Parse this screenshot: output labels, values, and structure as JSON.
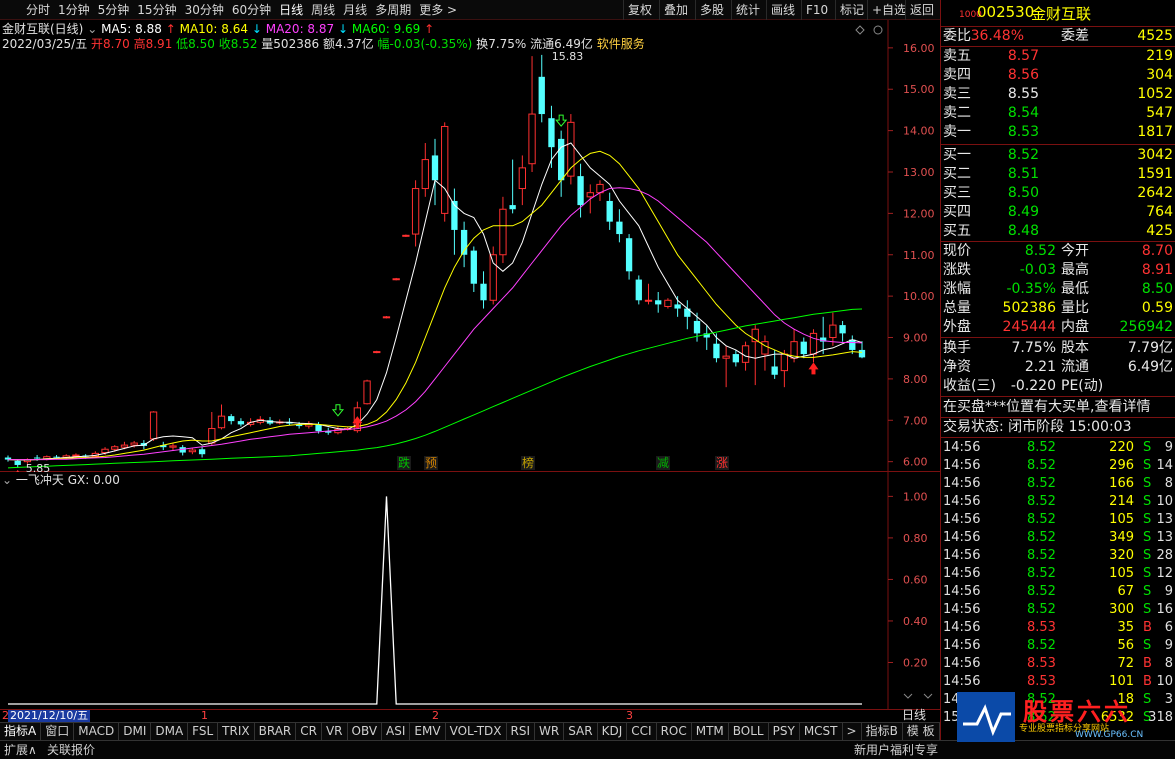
{
  "toolbar": {
    "timeframes": [
      "分时",
      "1分钟",
      "5分钟",
      "15分钟",
      "30分钟",
      "60分钟",
      "日线",
      "周线",
      "月线",
      "多周期",
      "更多 >"
    ],
    "active_timeframe": "日线",
    "right_buttons": [
      "复权",
      "叠加",
      "多股",
      "统计",
      "画线",
      "F10",
      "标记",
      "+自选",
      "返回"
    ]
  },
  "chart_header": {
    "title": "金财互联(日线)",
    "ma5": "MA5: 8.88",
    "ma10": "MA10: 8.64",
    "ma20": "MA20: 8.87",
    "ma60": "MA60: 9.69",
    "date": "2022/03/25/五",
    "open": "开8.70",
    "high": "高8.91",
    "low": "低8.50",
    "close": "收8.52",
    "vol": "量502386",
    "amount": "额4.37亿",
    "change": "幅-0.03(-0.35%)",
    "turnover": "换7.75%",
    "float": "流通6.49亿",
    "industry": "软件服务"
  },
  "chart_annotations": {
    "high_label": "15.83",
    "low_label": "5.85",
    "tags": [
      "跌",
      "预",
      "榜",
      "减",
      "涨"
    ]
  },
  "indicator_header": {
    "name": "一飞冲天",
    "gx": "GX: 0.00"
  },
  "bottom_axis": {
    "date_box": "2021/12/10/五",
    "months": [
      "1",
      "2",
      "3"
    ],
    "period": "日线"
  },
  "tabs": [
    "指标A",
    "窗口",
    "MACD",
    "DMI",
    "DMA",
    "FSL",
    "TRIX",
    "BRAR",
    "CR",
    "VR",
    "OBV",
    "ASI",
    "EMV",
    "VOL-TDX",
    "RSI",
    "WR",
    "SAR",
    "KDJ",
    "CCI",
    "ROC",
    "MTM",
    "BOLL",
    "PSY",
    "MCST",
    ">",
    "指标B",
    "模 板"
  ],
  "status": {
    "expand": "扩展∧",
    "linked": "关联报价",
    "news": "新用户福利专享"
  },
  "stock": {
    "code_prefix": "1000",
    "code": "002530",
    "name": "金财互联",
    "weibi_label": "委比",
    "weibi": "36.48%",
    "weicha_label": "委差",
    "weicha": "4525"
  },
  "asks": [
    {
      "label": "卖五",
      "price": "8.57",
      "vol": "219"
    },
    {
      "label": "卖四",
      "price": "8.56",
      "vol": "304"
    },
    {
      "label": "卖三",
      "price": "8.55",
      "vol": "1052"
    },
    {
      "label": "卖二",
      "price": "8.54",
      "vol": "547"
    },
    {
      "label": "卖一",
      "price": "8.53",
      "vol": "1817"
    }
  ],
  "bids": [
    {
      "label": "买一",
      "price": "8.52",
      "vol": "3042"
    },
    {
      "label": "买二",
      "price": "8.51",
      "vol": "1591"
    },
    {
      "label": "买三",
      "price": "8.50",
      "vol": "2642"
    },
    {
      "label": "买四",
      "price": "8.49",
      "vol": "764"
    },
    {
      "label": "买五",
      "price": "8.48",
      "vol": "425"
    }
  ],
  "quote": [
    {
      "l1": "现价",
      "v1": "8.52",
      "l2": "今开",
      "v2": "8.70"
    },
    {
      "l1": "涨跌",
      "v1": "-0.03",
      "l2": "最高",
      "v2": "8.91"
    },
    {
      "l1": "涨幅",
      "v1": "-0.35%",
      "l2": "最低",
      "v2": "8.50"
    },
    {
      "l1": "总量",
      "v1": "502386",
      "l2": "量比",
      "v2": "0.59"
    },
    {
      "l1": "外盘",
      "v1": "245444",
      "l2": "内盘",
      "v2": "256942"
    }
  ],
  "quote2": [
    {
      "l1": "换手",
      "v1": "7.75%",
      "l2": "股本",
      "v2": "7.79亿"
    },
    {
      "l1": "净资",
      "v1": "2.21",
      "l2": "流通",
      "v2": "6.49亿"
    },
    {
      "l1": "收益(三)",
      "v1": "-0.220",
      "l2": "PE(动)",
      "v2": ""
    }
  ],
  "notice": "在买盘***位置有大买单,查看详情",
  "trade_status": "交易状态: 闭市阶段 15:00:03",
  "ticks": [
    {
      "t": "14:56",
      "p": "8.52",
      "q": "220",
      "d": "S",
      "n": "9"
    },
    {
      "t": "14:56",
      "p": "8.52",
      "q": "296",
      "d": "S",
      "n": "14"
    },
    {
      "t": "14:56",
      "p": "8.52",
      "q": "166",
      "d": "S",
      "n": "8"
    },
    {
      "t": "14:56",
      "p": "8.52",
      "q": "214",
      "d": "S",
      "n": "10"
    },
    {
      "t": "14:56",
      "p": "8.52",
      "q": "105",
      "d": "S",
      "n": "13"
    },
    {
      "t": "14:56",
      "p": "8.52",
      "q": "349",
      "d": "S",
      "n": "13"
    },
    {
      "t": "14:56",
      "p": "8.52",
      "q": "320",
      "d": "S",
      "n": "28"
    },
    {
      "t": "14:56",
      "p": "8.52",
      "q": "105",
      "d": "S",
      "n": "12"
    },
    {
      "t": "14:56",
      "p": "8.52",
      "q": "67",
      "d": "S",
      "n": "9"
    },
    {
      "t": "14:56",
      "p": "8.52",
      "q": "300",
      "d": "S",
      "n": "16"
    },
    {
      "t": "14:56",
      "p": "8.53",
      "q": "35",
      "d": "B",
      "n": "6"
    },
    {
      "t": "14:56",
      "p": "8.52",
      "q": "56",
      "d": "S",
      "n": "9"
    },
    {
      "t": "14:56",
      "p": "8.53",
      "q": "72",
      "d": "B",
      "n": "8"
    },
    {
      "t": "14:56",
      "p": "8.53",
      "q": "101",
      "d": "B",
      "n": "10"
    },
    {
      "t": "14:57",
      "p": "8.52",
      "q": "18",
      "d": "S",
      "n": "3"
    },
    {
      "t": "15:00",
      "p": "8.52",
      "q": "6532",
      "d": "S",
      "n": "318"
    }
  ],
  "watermark": {
    "text": "股票六六",
    "url": "WWW.GP66.CN",
    "slogan": "专业股票指标分享网站"
  },
  "chart_data": [
    {
      "type": "candlestick",
      "title": "金财互联(日线)",
      "y_ticks": [
        "16.00",
        "15.00",
        "14.00",
        "13.00",
        "12.00",
        "11.00",
        "10.00",
        "9.00",
        "8.00",
        "7.00",
        "6.00"
      ],
      "ylim": [
        5.75,
        16.4
      ],
      "candles": [
        [
          6.1,
          6.05,
          6.15,
          6.0
        ],
        [
          6.02,
          5.92,
          6.06,
          5.85
        ],
        [
          6.0,
          6.05,
          6.08,
          5.95
        ],
        [
          6.1,
          6.08,
          6.16,
          6.02
        ],
        [
          6.07,
          6.12,
          6.15,
          6.03
        ],
        [
          6.12,
          6.1,
          6.16,
          6.05
        ],
        [
          6.1,
          6.14,
          6.18,
          6.06
        ],
        [
          6.14,
          6.16,
          6.2,
          6.08
        ],
        [
          6.15,
          6.12,
          6.18,
          6.07
        ],
        [
          6.13,
          6.2,
          6.25,
          6.1
        ],
        [
          6.22,
          6.3,
          6.35,
          6.16
        ],
        [
          6.3,
          6.36,
          6.4,
          6.24
        ],
        [
          6.35,
          6.4,
          6.48,
          6.3
        ],
        [
          6.4,
          6.45,
          6.5,
          6.34
        ],
        [
          6.45,
          6.38,
          6.52,
          6.3
        ],
        [
          6.55,
          7.2,
          7.22,
          6.5
        ],
        [
          6.4,
          6.35,
          6.48,
          6.28
        ],
        [
          6.35,
          6.38,
          6.44,
          6.28
        ],
        [
          6.35,
          6.22,
          6.4,
          6.15
        ],
        [
          6.24,
          6.28,
          6.34,
          6.18
        ],
        [
          6.3,
          6.18,
          6.36,
          6.1
        ],
        [
          6.45,
          6.8,
          7.2,
          6.4
        ],
        [
          6.82,
          7.1,
          7.38,
          6.78
        ],
        [
          7.1,
          6.98,
          7.15,
          6.9
        ],
        [
          6.98,
          6.9,
          7.05,
          6.85
        ],
        [
          6.9,
          6.95,
          7.05,
          6.85
        ],
        [
          6.95,
          7.02,
          7.1,
          6.9
        ],
        [
          7.0,
          6.92,
          7.08,
          6.88
        ],
        [
          6.94,
          6.96,
          7.02,
          6.9
        ],
        [
          6.96,
          6.92,
          7.05,
          6.88
        ],
        [
          6.9,
          6.86,
          6.96,
          6.8
        ],
        [
          6.86,
          6.92,
          6.98,
          6.8
        ],
        [
          6.9,
          6.74,
          6.96,
          6.68
        ],
        [
          6.74,
          6.7,
          6.82,
          6.65
        ],
        [
          6.7,
          6.78,
          6.86,
          6.66
        ],
        [
          6.78,
          6.8,
          6.85,
          6.75
        ],
        [
          6.75,
          7.3,
          7.45,
          6.7
        ],
        [
          7.4,
          7.95,
          7.98,
          7.38
        ],
        [
          8.65,
          8.66,
          8.68,
          8.62
        ],
        [
          9.48,
          9.5,
          9.52,
          9.46
        ],
        [
          10.4,
          10.42,
          10.44,
          10.38
        ],
        [
          11.45,
          11.47,
          11.49,
          11.43
        ],
        [
          11.5,
          12.6,
          12.8,
          11.2
        ],
        [
          12.6,
          13.3,
          13.7,
          12.4
        ],
        [
          13.4,
          12.8,
          13.8,
          12.2
        ],
        [
          12.0,
          14.1,
          14.2,
          11.8
        ],
        [
          12.3,
          11.6,
          12.6,
          11.0
        ],
        [
          11.6,
          11.0,
          11.8,
          10.7
        ],
        [
          11.1,
          10.3,
          11.2,
          10.1
        ],
        [
          10.3,
          9.9,
          10.6,
          9.7
        ],
        [
          9.9,
          11.0,
          11.2,
          9.8
        ],
        [
          11.0,
          12.1,
          12.4,
          10.8
        ],
        [
          12.2,
          12.1,
          13.3,
          12.0
        ],
        [
          12.6,
          13.1,
          13.4,
          12.2
        ],
        [
          13.2,
          14.4,
          15.8,
          13.0
        ],
        [
          15.3,
          14.4,
          15.83,
          14.2
        ],
        [
          14.3,
          13.6,
          14.6,
          13.1
        ],
        [
          13.8,
          12.8,
          14.0,
          12.4
        ],
        [
          12.9,
          14.2,
          14.4,
          12.7
        ],
        [
          12.9,
          12.2,
          13.2,
          11.9
        ],
        [
          12.4,
          12.5,
          12.7,
          12.0
        ],
        [
          12.5,
          12.7,
          12.8,
          12.3
        ],
        [
          12.3,
          11.8,
          12.5,
          11.6
        ],
        [
          11.8,
          11.5,
          12.1,
          11.3
        ],
        [
          11.4,
          10.6,
          11.5,
          10.4
        ],
        [
          10.4,
          9.9,
          10.5,
          9.8
        ],
        [
          9.9,
          9.9,
          10.3,
          9.8
        ],
        [
          9.9,
          9.8,
          10.1,
          9.6
        ],
        [
          9.75,
          9.9,
          9.95,
          9.7
        ],
        [
          9.8,
          9.7,
          10.0,
          9.5
        ],
        [
          9.7,
          9.5,
          9.9,
          9.2
        ],
        [
          9.4,
          9.1,
          9.6,
          8.9
        ],
        [
          9.1,
          9.0,
          9.3,
          8.7
        ],
        [
          8.85,
          8.5,
          9.1,
          8.4
        ],
        [
          8.5,
          8.55,
          8.8,
          7.8
        ],
        [
          8.6,
          8.4,
          8.7,
          8.3
        ],
        [
          8.4,
          8.8,
          8.9,
          8.2
        ],
        [
          8.9,
          9.2,
          9.3,
          7.85
        ],
        [
          8.6,
          8.9,
          9.05,
          8.2
        ],
        [
          8.3,
          8.1,
          8.7,
          8.0
        ],
        [
          8.2,
          8.6,
          8.7,
          7.8
        ],
        [
          8.5,
          8.9,
          9.2,
          8.4
        ],
        [
          8.9,
          8.6,
          9.0,
          8.5
        ],
        [
          8.6,
          9.1,
          9.2,
          8.4
        ],
        [
          9.0,
          8.9,
          9.5,
          8.6
        ],
        [
          9.0,
          9.3,
          9.6,
          8.8
        ],
        [
          9.3,
          9.1,
          9.4,
          8.9
        ],
        [
          8.95,
          8.7,
          9.05,
          8.6
        ],
        [
          8.7,
          8.52,
          8.91,
          8.5
        ]
      ],
      "ma5": [
        6.05,
        6.04,
        6.04,
        6.05,
        6.07,
        6.08,
        6.1,
        6.12,
        6.13,
        6.15,
        6.2,
        6.26,
        6.32,
        6.38,
        6.4,
        6.55,
        6.6,
        6.62,
        6.6,
        6.58,
        6.4,
        6.45,
        6.55,
        6.7,
        6.8,
        6.95,
        7.0,
        6.97,
        6.95,
        6.95,
        6.93,
        6.92,
        6.9,
        6.85,
        6.8,
        6.78,
        6.9,
        7.15,
        7.5,
        8.15,
        9.0,
        9.9,
        10.8,
        11.8,
        12.8,
        12.6,
        12.2,
        12.0,
        11.9,
        11.5,
        10.8,
        10.6,
        10.8,
        11.3,
        12.0,
        12.7,
        13.3,
        13.6,
        13.7,
        13.4,
        13.1,
        12.9,
        12.7,
        12.3,
        12.0,
        11.7,
        11.2,
        10.7,
        10.3,
        9.9,
        9.7,
        9.5,
        9.3,
        9.0,
        8.8,
        8.7,
        8.55,
        8.5,
        8.55,
        8.6,
        8.6,
        8.5,
        8.55,
        8.6,
        8.7,
        8.75,
        8.85,
        8.95,
        8.88
      ],
      "ma10": [
        6.05,
        6.05,
        6.05,
        6.05,
        6.06,
        6.07,
        6.08,
        6.09,
        6.1,
        6.11,
        6.13,
        6.16,
        6.2,
        6.24,
        6.28,
        6.34,
        6.4,
        6.45,
        6.5,
        6.52,
        6.5,
        6.5,
        6.55,
        6.6,
        6.65,
        6.7,
        6.75,
        6.8,
        6.85,
        6.88,
        6.9,
        6.9,
        6.9,
        6.88,
        6.86,
        6.84,
        6.85,
        6.9,
        7.0,
        7.2,
        7.5,
        7.9,
        8.4,
        9.0,
        9.6,
        10.2,
        10.7,
        11.1,
        11.4,
        11.6,
        11.7,
        11.7,
        11.7,
        11.8,
        12.0,
        12.2,
        12.5,
        12.8,
        13.1,
        13.3,
        13.45,
        13.5,
        13.4,
        13.2,
        12.9,
        12.6,
        12.2,
        11.8,
        11.4,
        11.0,
        10.7,
        10.4,
        10.1,
        9.8,
        9.55,
        9.3,
        9.1,
        8.95,
        8.8,
        8.7,
        8.6,
        8.55,
        8.52,
        8.52,
        8.55,
        8.58,
        8.62,
        8.66,
        8.64
      ],
      "ma20": [
        6.05,
        6.05,
        6.05,
        6.05,
        6.05,
        6.06,
        6.06,
        6.07,
        6.08,
        6.09,
        6.1,
        6.12,
        6.14,
        6.16,
        6.18,
        6.21,
        6.24,
        6.27,
        6.3,
        6.33,
        6.36,
        6.39,
        6.42,
        6.46,
        6.5,
        6.54,
        6.57,
        6.6,
        6.63,
        6.66,
        6.68,
        6.7,
        6.72,
        6.74,
        6.76,
        6.78,
        6.8,
        6.84,
        6.9,
        6.98,
        7.1,
        7.25,
        7.45,
        7.7,
        8.0,
        8.3,
        8.6,
        8.9,
        9.2,
        9.45,
        9.7,
        9.95,
        10.2,
        10.5,
        10.8,
        11.1,
        11.4,
        11.7,
        11.95,
        12.15,
        12.35,
        12.5,
        12.6,
        12.62,
        12.6,
        12.55,
        12.45,
        12.3,
        12.1,
        11.9,
        11.7,
        11.5,
        11.3,
        11.05,
        10.8,
        10.55,
        10.3,
        10.05,
        9.8,
        9.55,
        9.35,
        9.2,
        9.08,
        8.98,
        8.92,
        8.9,
        8.88,
        8.88,
        8.87
      ],
      "ma60": [
        5.85,
        5.86,
        5.87,
        5.88,
        5.89,
        5.9,
        5.91,
        5.92,
        5.93,
        5.94,
        5.95,
        5.96,
        5.97,
        5.98,
        5.99,
        6.0,
        6.01,
        6.02,
        6.03,
        6.04,
        6.05,
        6.06,
        6.07,
        6.08,
        6.09,
        6.1,
        6.11,
        6.12,
        6.13,
        6.14,
        6.16,
        6.18,
        6.2,
        6.22,
        6.24,
        6.26,
        6.28,
        6.31,
        6.34,
        6.38,
        6.43,
        6.49,
        6.56,
        6.64,
        6.73,
        6.83,
        6.93,
        7.03,
        7.13,
        7.23,
        7.33,
        7.43,
        7.53,
        7.63,
        7.73,
        7.83,
        7.93,
        8.03,
        8.12,
        8.21,
        8.3,
        8.38,
        8.46,
        8.54,
        8.61,
        8.68,
        8.74,
        8.8,
        8.86,
        8.92,
        8.98,
        9.03,
        9.08,
        9.13,
        9.18,
        9.23,
        9.28,
        9.32,
        9.36,
        9.4,
        9.44,
        9.48,
        9.52,
        9.56,
        9.59,
        9.62,
        9.65,
        9.68,
        9.69
      ]
    },
    {
      "type": "line",
      "title": "一飞冲天",
      "y_ticks": [
        "1.00",
        "0.80",
        "0.60",
        "0.40",
        "0.20"
      ],
      "ylim": [
        0,
        1.05
      ],
      "series": [
        {
          "name": "GX",
          "spike_index": 39,
          "values_default": 0,
          "spike_value": 1.0
        }
      ]
    }
  ]
}
